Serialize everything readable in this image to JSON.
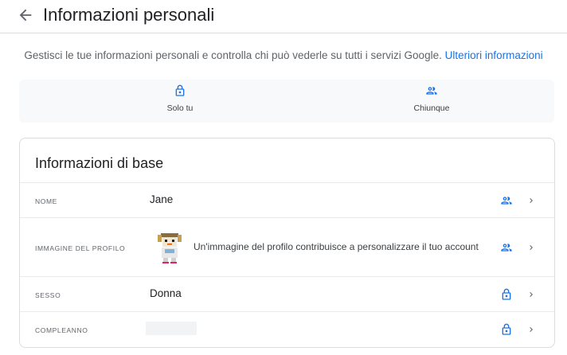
{
  "header": {
    "title": "Informazioni personali"
  },
  "intro": {
    "text": "Gestisci le tue informazioni personali e controlla chi può vederle su tutti i servizi Google.",
    "link": "Ulteriori informazioni"
  },
  "legend": [
    {
      "label": "Solo tu",
      "icon": "lock-icon"
    },
    {
      "label": "Chiunque",
      "icon": "people-icon"
    }
  ],
  "card": {
    "title": "Informazioni di base",
    "rows": [
      {
        "label": "NOME",
        "value": "Jane",
        "visibility_icon": "people-icon"
      },
      {
        "label": "IMMAGINE DEL PROFILO",
        "description": "Un'immagine del profilo contribuisce a personalizzare il tuo account",
        "visibility_icon": "people-icon"
      },
      {
        "label": "SESSO",
        "value": "Donna",
        "visibility_icon": "lock-icon"
      },
      {
        "label": "COMPLEANNO",
        "value": "",
        "visibility_icon": "lock-icon"
      }
    ]
  },
  "colors": {
    "accent": "#1a73e8",
    "text": "#202124",
    "secondary": "#5f6368",
    "divider": "#dadce0",
    "legend_bg": "#f8f9fa"
  }
}
